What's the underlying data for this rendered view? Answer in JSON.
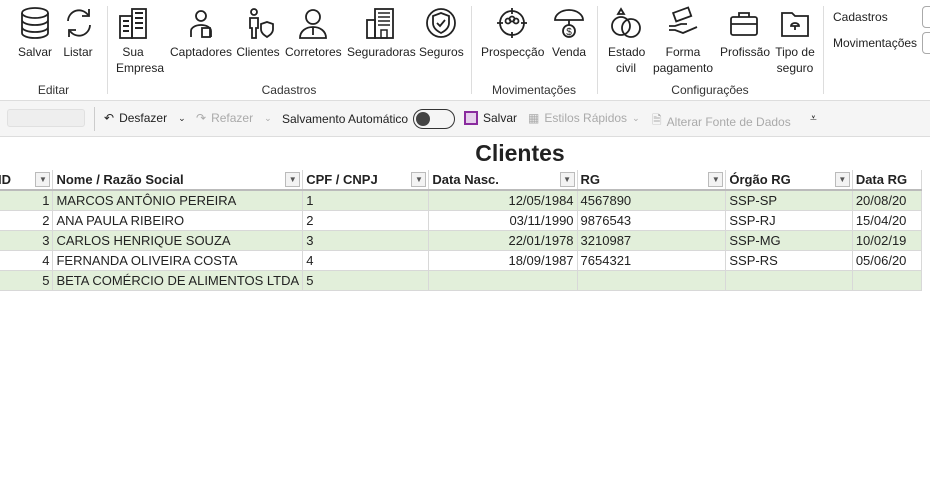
{
  "ribbon": {
    "groups": [
      {
        "label": "Editar"
      },
      {
        "label": "Cadastros"
      },
      {
        "label": "Movimentações"
      },
      {
        "label": "Configurações"
      }
    ],
    "buttons": [
      {
        "label": "Salvar",
        "icon": "database-icon"
      },
      {
        "label": "Listar",
        "icon": "refresh-icon"
      },
      {
        "label": "Sua Empresa",
        "icon": "building-icon"
      },
      {
        "label": "Captadores",
        "icon": "agent-icon"
      },
      {
        "label": "Clientes",
        "icon": "client-shield-icon"
      },
      {
        "label": "Corretores",
        "icon": "broker-icon"
      },
      {
        "label": "Seguradoras",
        "icon": "office-building-icon"
      },
      {
        "label": "Seguros",
        "icon": "shield-check-icon"
      },
      {
        "label": "Prospecção",
        "icon": "target-group-icon"
      },
      {
        "label": "Venda",
        "icon": "umbrella-dollar-icon"
      },
      {
        "label": "Estado civil",
        "icon": "rings-icon"
      },
      {
        "label": "Forma pagamento",
        "icon": "hand-money-icon"
      },
      {
        "label": "Profissão",
        "icon": "briefcase-icon"
      },
      {
        "label": "Tipo de seguro",
        "icon": "folder-umbrella-icon"
      }
    ],
    "side": {
      "cadastros": "Cadastros",
      "movimentacoes": "Movimentações"
    }
  },
  "toolbar": {
    "undo": "Desfazer",
    "redo": "Refazer",
    "autosave": "Salvamento Automático",
    "autosave_on": false,
    "save": "Salvar",
    "quick_styles": "Estilos Rápidos",
    "change_source": "Alterar Fonte de Dados"
  },
  "sheet": {
    "title": "Clientes",
    "headers": [
      "ID",
      "Nome / Razão Social",
      "CPF / CNPJ",
      "Data Nasc.",
      "RG",
      "Órgão RG",
      "Data RG"
    ],
    "rows": [
      [
        "1",
        "MARCOS ANTÔNIO PEREIRA",
        "1",
        "12/05/1984",
        "4567890",
        "SSP-SP",
        "20/08/20"
      ],
      [
        "2",
        "ANA PAULA RIBEIRO",
        "2",
        "03/11/1990",
        "9876543",
        "SSP-RJ",
        "15/04/20"
      ],
      [
        "3",
        "CARLOS HENRIQUE SOUZA",
        "3",
        "22/01/1978",
        "3210987",
        "SSP-MG",
        "10/02/19"
      ],
      [
        "4",
        "FERNANDA OLIVEIRA COSTA",
        "4",
        "18/09/1987",
        "7654321",
        "SSP-RS",
        "05/06/20"
      ],
      [
        "5",
        "BETA COMÉRCIO DE ALIMENTOS LTDA",
        "5",
        "",
        "",
        "",
        ""
      ]
    ]
  }
}
